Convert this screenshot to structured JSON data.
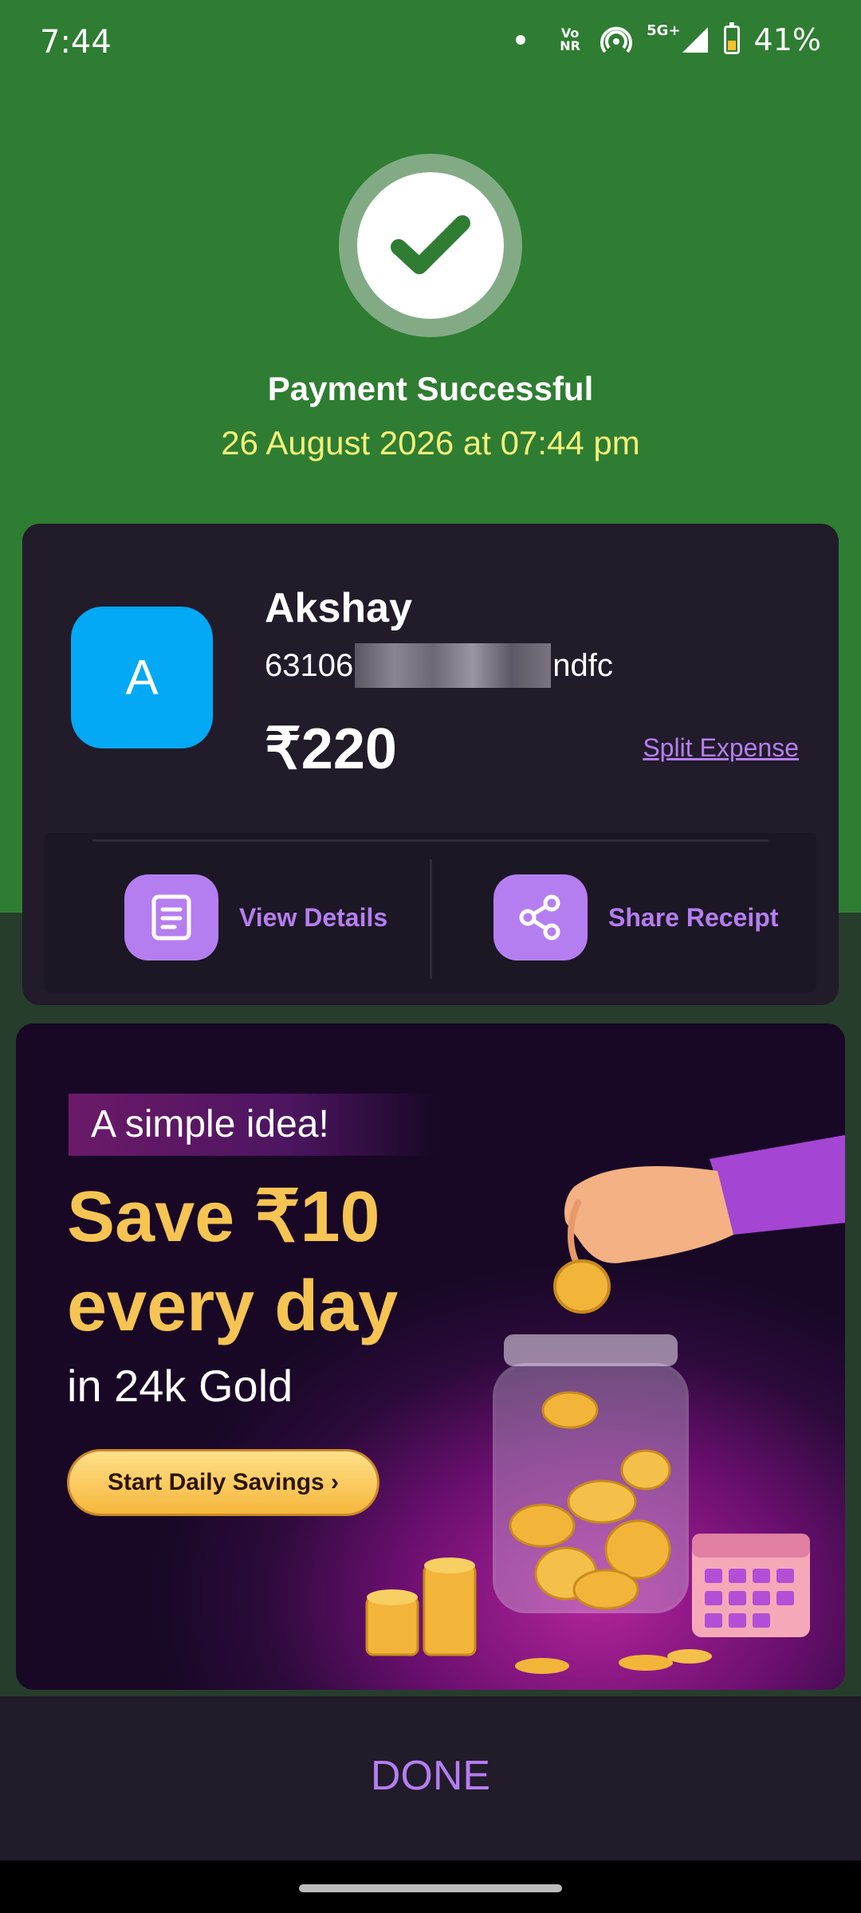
{
  "status_bar": {
    "time": "7:44",
    "network_volte": "Vo NR",
    "network_type": "5G+",
    "battery_percent": "41%",
    "battery_level": 0.41,
    "icons": [
      "notification-dot-icon",
      "volte-icon",
      "hotspot-icon",
      "signal-icon",
      "battery-icon"
    ]
  },
  "header": {
    "title": "Payment Successful",
    "datetime": "26 August 2026 at 07:44 pm",
    "icon": "check-icon"
  },
  "payee": {
    "avatar_letter": "A",
    "name": "Akshay",
    "upi_prefix": "63106",
    "upi_suffix": "ndfc",
    "amount": "₹220",
    "split_link": "Split Expense "
  },
  "actions": {
    "view_details": "View Details",
    "share_receipt": "Share Receipt"
  },
  "banner": {
    "tag": "A simple idea!",
    "headline_1": "Save ₹10",
    "headline_2": "every day",
    "subline": "in 24k Gold",
    "cta": "Start Daily Savings ›"
  },
  "footer": {
    "done": "DONE"
  },
  "colors": {
    "success_green": "#2e7d32",
    "card_bg": "#211b2a",
    "accent_purple": "#b57ef0",
    "avatar_blue": "#03a9f4",
    "date_yellow": "#f4f17a",
    "gold": "#f6c453"
  }
}
